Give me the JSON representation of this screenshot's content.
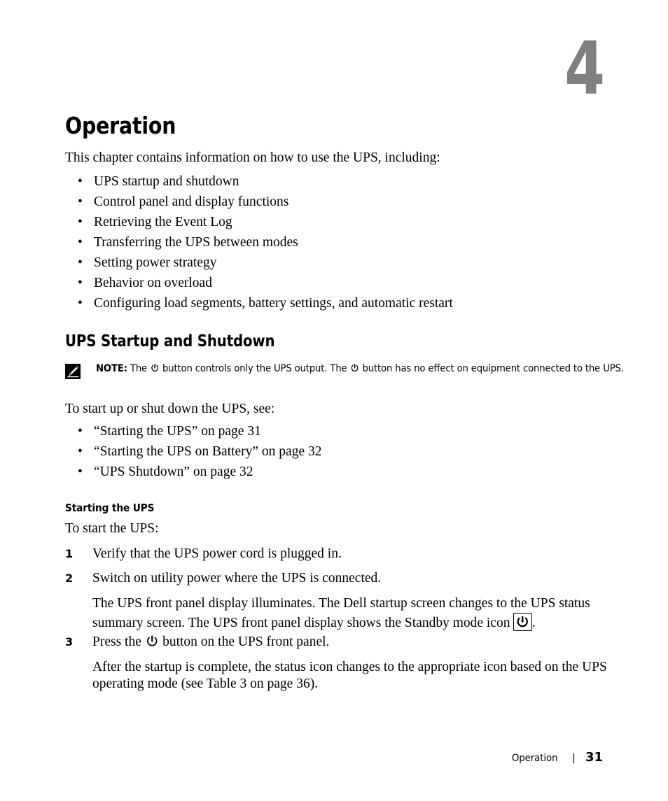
{
  "chapter": {
    "number": "4",
    "title": "Operation",
    "intro": "This chapter contains information on how to use the UPS, including:",
    "topics": [
      "UPS startup and shutdown",
      "Control panel and display functions",
      "Retrieving the Event Log",
      "Transferring the UPS between modes",
      "Setting power strategy",
      "Behavior on overload",
      "Configuring load segments, battery settings, and automatic restart"
    ],
    "bullet_glyph": "•"
  },
  "section": {
    "heading": "UPS Startup and Shutdown",
    "note": {
      "icon_name": "note-pencil-icon",
      "label": "NOTE:",
      "text_part_1": " The ",
      "text_part_2": " button controls only the UPS output. The ",
      "text_part_3": " button has no effect on equipment connected to the UPS."
    },
    "lead_in": "To start up or shut down the UPS, see:",
    "cross_references": [
      "“Starting the UPS” on page 31",
      "“Starting the UPS on Battery” on page 32",
      "“UPS Shutdown” on page 32"
    ]
  },
  "subsection": {
    "heading": "Starting the UPS",
    "lead_in": "To start the UPS:",
    "steps": [
      {
        "number": "1",
        "text": "Verify that the UPS power cord is plugged in."
      },
      {
        "number": "2",
        "text": "Switch on utility power where the UPS is connected."
      },
      {
        "number": "3",
        "text_before_icon": "Press the ",
        "text_after_icon": " button on the UPS front panel."
      }
    ],
    "step2_continuation_part_1": "The UPS front panel display illuminates. The Dell startup screen changes to the UPS status summary screen. The UPS front panel display shows the Standby mode icon ",
    "step2_continuation_part_2": ".",
    "step3_continuation": "After the startup is complete, the status icon changes to the appropriate icon based on the UPS operating mode (see Table 3 on page 36)."
  },
  "footer": {
    "chapter_label": "Operation",
    "separator": "|",
    "page_number": "31"
  },
  "colors": {
    "chapter_number_gray": "#808080",
    "text_black": "#000000",
    "page_background": "#ffffff"
  }
}
